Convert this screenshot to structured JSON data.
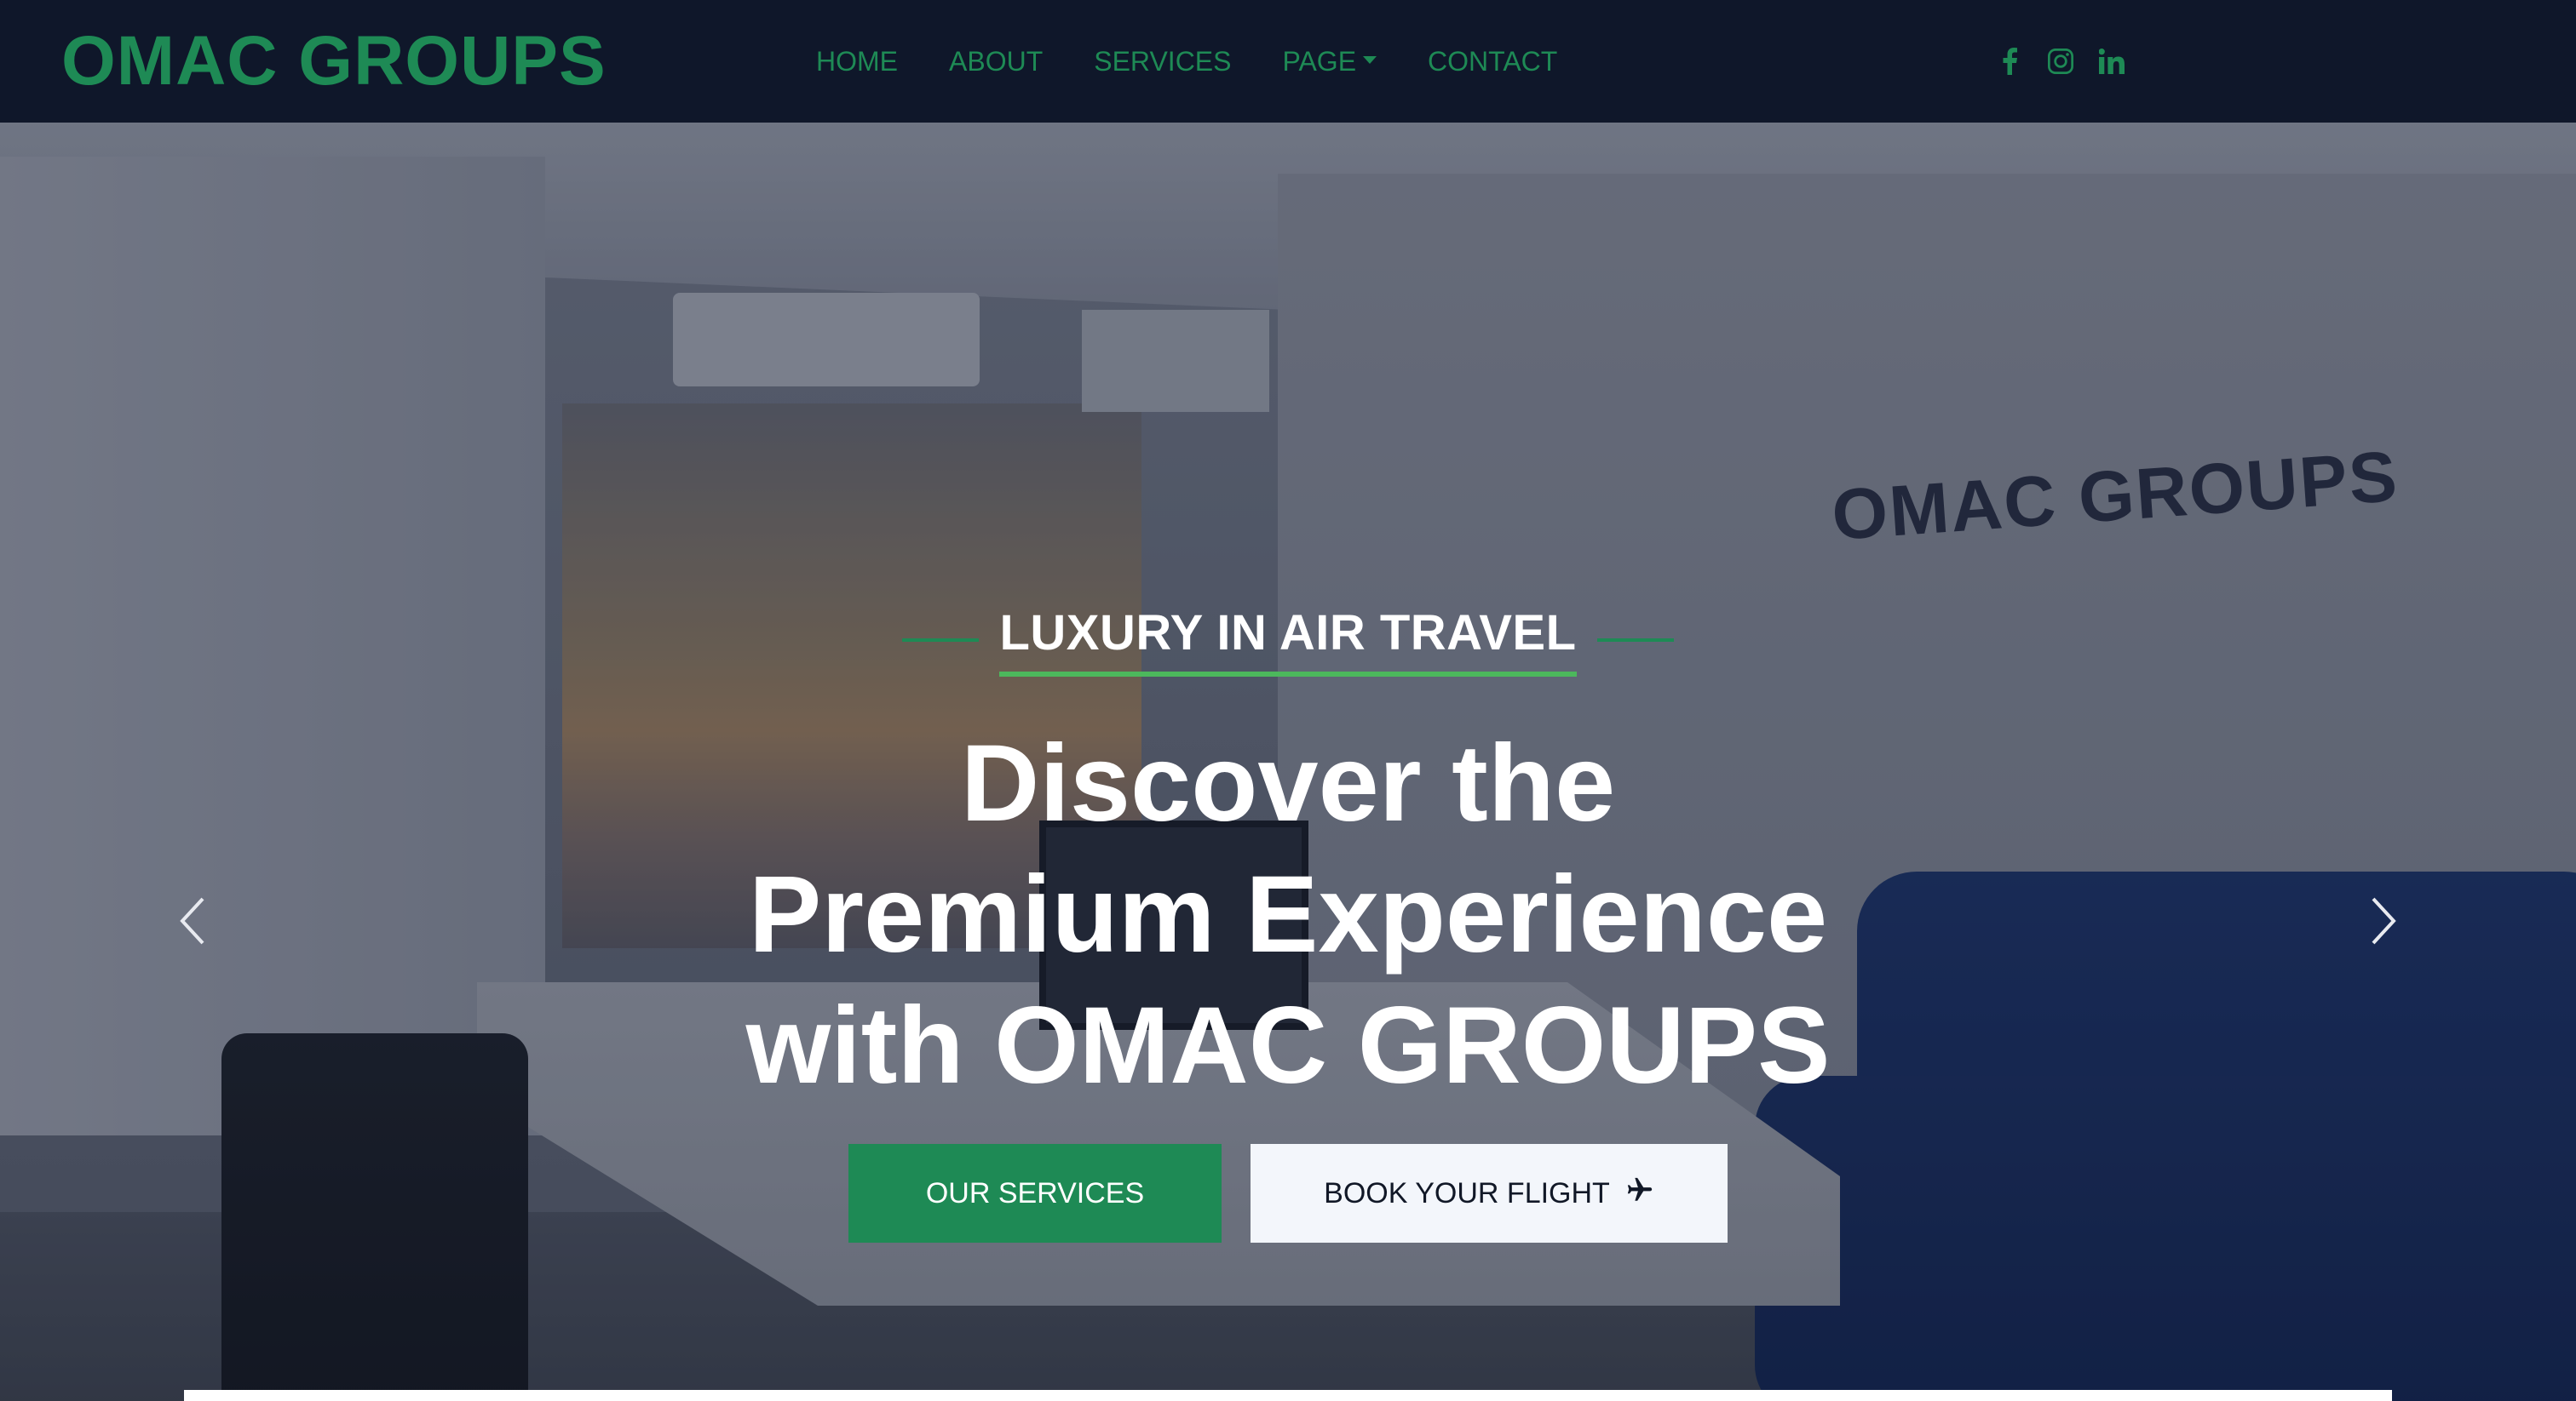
{
  "brand": {
    "name": "OMAC GROUPS"
  },
  "nav": {
    "items": [
      {
        "label": "HOME"
      },
      {
        "label": "ABOUT"
      },
      {
        "label": "SERVICES"
      },
      {
        "label": "PAGE"
      },
      {
        "label": "CONTACT"
      }
    ]
  },
  "socials": [
    {
      "icon": "facebook-icon"
    },
    {
      "icon": "instagram-icon"
    },
    {
      "icon": "linkedin-icon"
    }
  ],
  "hero": {
    "subtitle": "LUXURY IN AIR TRAVEL",
    "headline": {
      "line1": "Discover the",
      "line2": "Premium Experience",
      "line3": "with OMAC GROUPS"
    },
    "wall_logo": "OMAC GROUPS",
    "primary_button": "OUR SERVICES",
    "secondary_button": "BOOK YOUR FLIGHT",
    "secondary_button_icon": "airplane-icon",
    "prev_icon": "chevron-left-icon",
    "next_icon": "chevron-right-icon"
  },
  "colors": {
    "accent": "#1e8a55",
    "navbar": "#0f172a",
    "underline": "#4cb85c"
  }
}
